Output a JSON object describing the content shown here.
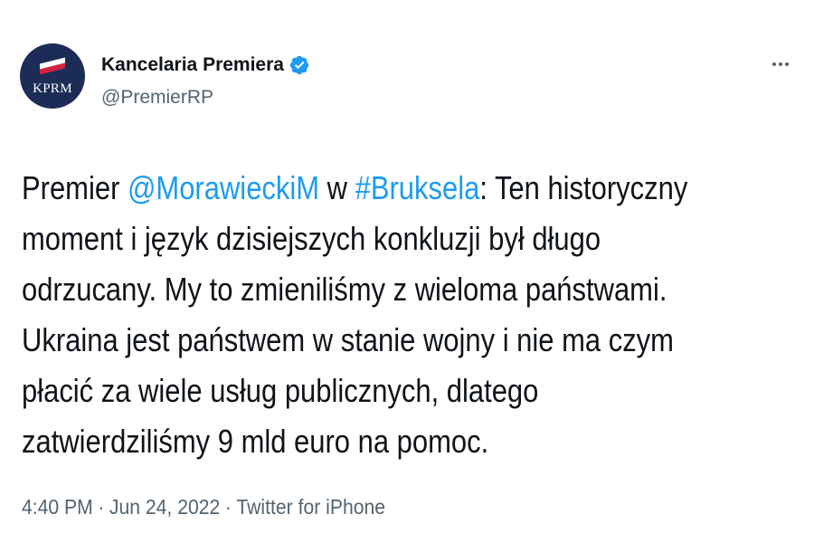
{
  "account": {
    "display_name": "Kancelaria Premiera",
    "handle": "@PremierRP",
    "avatar_text": "KPRM",
    "verified": true
  },
  "tweet": {
    "line1": {
      "t1": "Premier ",
      "mention": "@MorawieckiM",
      "t2": " w ",
      "hashtag": "#Bruksela",
      "t3": ": Ten historyczny"
    },
    "line2": "moment i język dzisiejszych konkluzji był długo",
    "line3": "odrzucany. My to zmieniliśmy z wieloma państwami.",
    "line4": "Ukraina jest państwem w stanie wojny i nie ma czym",
    "line5": "płacić za wiele usług publicznych, dlatego",
    "line6": "zatwierdziliśmy 9 mld euro na pomoc."
  },
  "meta": {
    "time": "4:40 PM",
    "separator": "·",
    "date": "Jun 24, 2022",
    "source": "Twitter for iPhone"
  },
  "colors": {
    "link": "#1d9bf0",
    "text": "#0f1419",
    "secondary": "#536471",
    "avatar_bg": "#1b2d57"
  },
  "icons": [
    "verified-badge-icon",
    "more-options-icon",
    "polish-flag-icon"
  ]
}
